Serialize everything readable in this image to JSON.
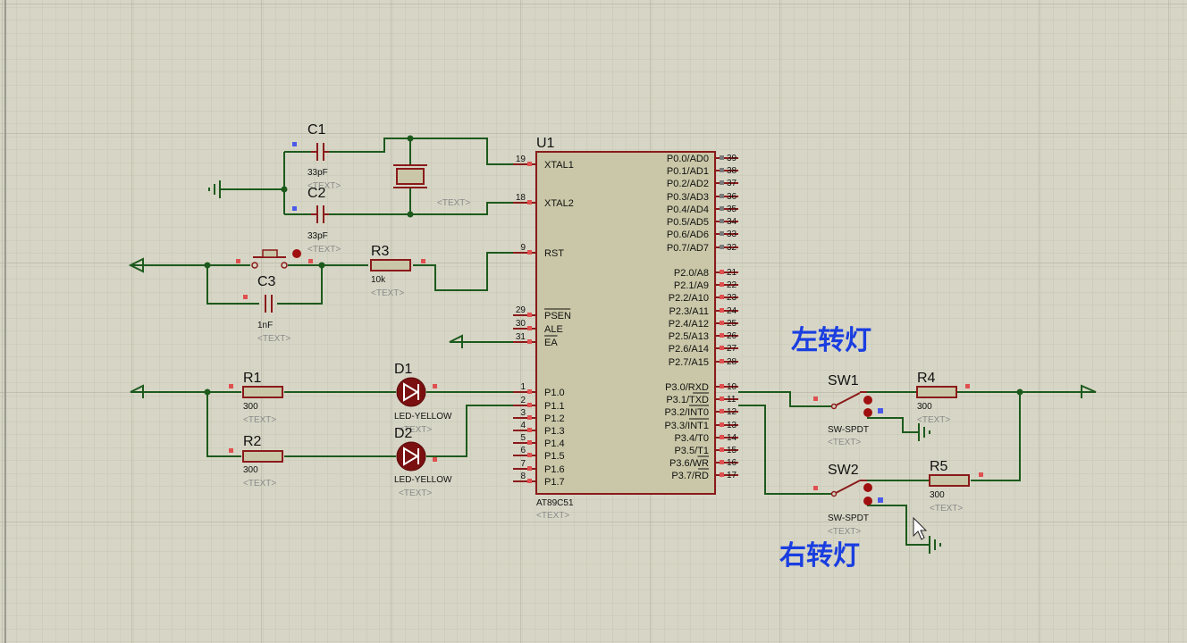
{
  "chip": {
    "ref": "U1",
    "part": "AT89C51",
    "text": "<TEXT>",
    "left_pins": [
      {
        "num": "19",
        "name": "XTAL1"
      },
      {
        "num": "18",
        "name": "XTAL2"
      },
      {
        "num": "9",
        "name": "RST"
      },
      {
        "num": "29",
        "name": "PSEN"
      },
      {
        "num": "30",
        "name": "ALE"
      },
      {
        "num": "31",
        "name": "EA"
      },
      {
        "num": "1",
        "name": "P1.0"
      },
      {
        "num": "2",
        "name": "P1.1"
      },
      {
        "num": "3",
        "name": "P1.2"
      },
      {
        "num": "4",
        "name": "P1.3"
      },
      {
        "num": "5",
        "name": "P1.4"
      },
      {
        "num": "6",
        "name": "P1.5"
      },
      {
        "num": "7",
        "name": "P1.6"
      },
      {
        "num": "8",
        "name": "P1.7"
      }
    ],
    "right_pins": [
      {
        "num": "39",
        "name": "P0.0/AD0"
      },
      {
        "num": "38",
        "name": "P0.1/AD1"
      },
      {
        "num": "37",
        "name": "P0.2/AD2"
      },
      {
        "num": "36",
        "name": "P0.3/AD3"
      },
      {
        "num": "35",
        "name": "P0.4/AD4"
      },
      {
        "num": "34",
        "name": "P0.5/AD5"
      },
      {
        "num": "33",
        "name": "P0.6/AD6"
      },
      {
        "num": "32",
        "name": "P0.7/AD7"
      },
      {
        "num": "21",
        "name": "P2.0/A8"
      },
      {
        "num": "22",
        "name": "P2.1/A9"
      },
      {
        "num": "23",
        "name": "P2.2/A10"
      },
      {
        "num": "24",
        "name": "P2.3/A11"
      },
      {
        "num": "25",
        "name": "P2.4/A12"
      },
      {
        "num": "26",
        "name": "P2.5/A13"
      },
      {
        "num": "27",
        "name": "P2.6/A14"
      },
      {
        "num": "28",
        "name": "P2.7/A15"
      },
      {
        "num": "10",
        "name": "P3.0/RXD"
      },
      {
        "num": "11",
        "name": "P3.1/TXD"
      },
      {
        "num": "12",
        "name": "P3.2/INT0"
      },
      {
        "num": "13",
        "name": "P3.3/INT1"
      },
      {
        "num": "14",
        "name": "P3.4/T0"
      },
      {
        "num": "15",
        "name": "P3.5/T1"
      },
      {
        "num": "16",
        "name": "P3.6/WR"
      },
      {
        "num": "17",
        "name": "P3.7/RD"
      }
    ]
  },
  "components": {
    "C1": {
      "ref": "C1",
      "value": "33pF",
      "text": "<TEXT>"
    },
    "C2": {
      "ref": "C2",
      "value": "33pF",
      "text": "<TEXT>"
    },
    "C3": {
      "ref": "C3",
      "value": "1nF",
      "text": "<TEXT>"
    },
    "R1": {
      "ref": "R1",
      "value": "300",
      "text": "<TEXT>"
    },
    "R2": {
      "ref": "R2",
      "value": "300",
      "text": "<TEXT>"
    },
    "R3": {
      "ref": "R3",
      "value": "10k",
      "text": "<TEXT>"
    },
    "R4": {
      "ref": "R4",
      "value": "300",
      "text": "<TEXT>"
    },
    "R5": {
      "ref": "R5",
      "value": "300",
      "text": "<TEXT>"
    },
    "D1": {
      "ref": "D1",
      "value": "LED-YELLOW",
      "text": "<TEXT>"
    },
    "D2": {
      "ref": "D2",
      "value": "LED-YELLOW",
      "text": "<TEXT>"
    },
    "SW1": {
      "ref": "SW1",
      "value": "SW-SPDT",
      "text": "<TEXT>"
    },
    "SW2": {
      "ref": "SW2",
      "value": "SW-SPDT",
      "text": "<TEXT>"
    },
    "X1": {
      "text": "<TEXT>"
    }
  },
  "annotations": {
    "left_turn": "左转灯",
    "right_turn": "右转灯"
  },
  "colors": {
    "background": "#d7d6c6",
    "grid_minor": "#c6c5b4",
    "grid_major": "#b4b3a2",
    "wire": "#1d5a1d",
    "component": "#8b1a1a",
    "chip_fill": "#c9c7a7",
    "pin_marker_red": "#e05050",
    "pin_marker_blue": "#4a5ae8",
    "annotation": "#1a3ee0"
  }
}
